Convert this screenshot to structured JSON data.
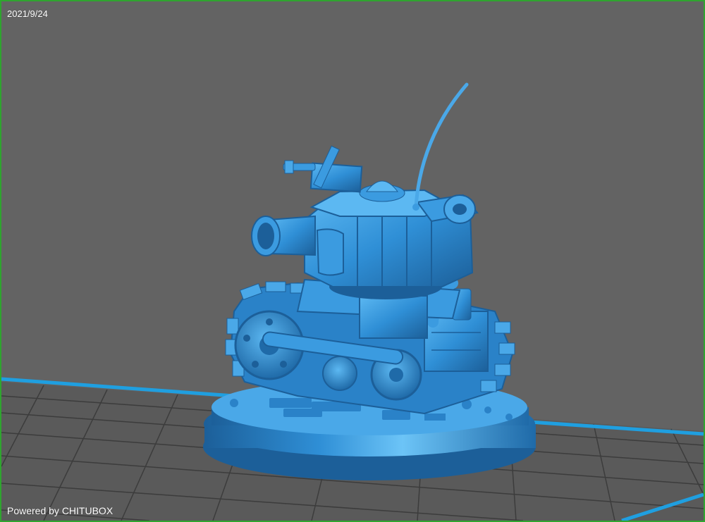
{
  "viewport": {
    "date": "2021/9/24",
    "watermark": "Powered by CHITUBOX",
    "colors": {
      "background": "#636363",
      "frame_border": "#2fa52f",
      "platform_grid": "#3c3c3c",
      "platform_edge": "#1f9fe0",
      "model_fill": "#2f8fd6",
      "model_highlight": "#5cb8f2",
      "model_shadow": "#1c5f99"
    }
  },
  "model": {
    "icon": "tank-model-icon"
  }
}
